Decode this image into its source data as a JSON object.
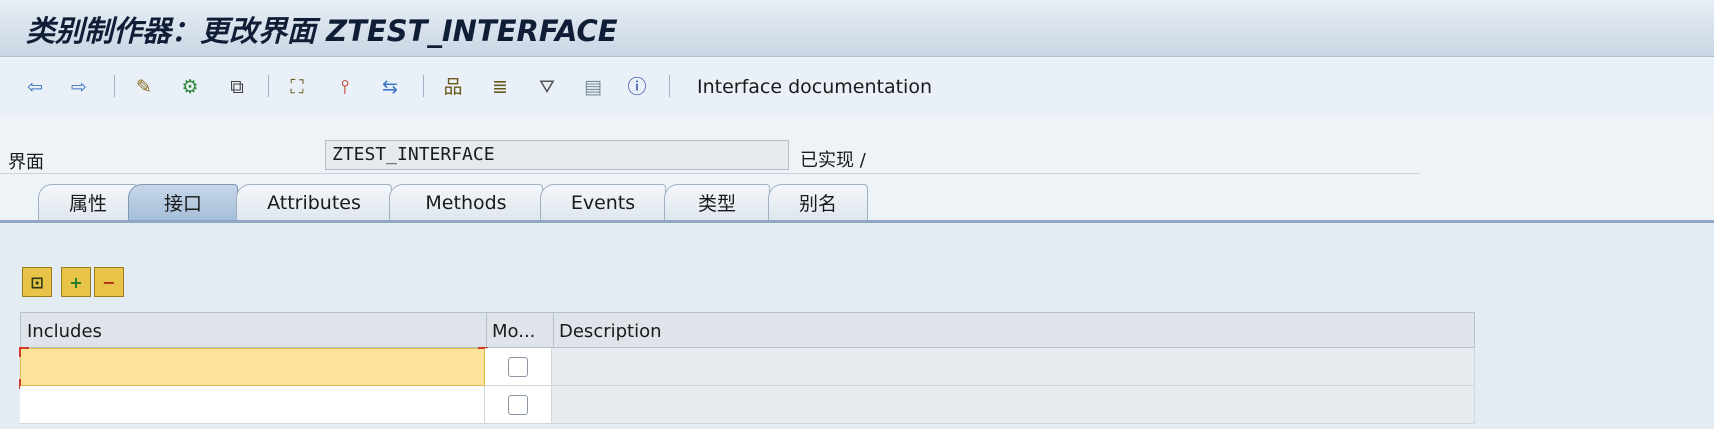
{
  "window": {
    "title": "类别制作器：更改界面 ZTEST_INTERFACE"
  },
  "toolbar": {
    "buttons": [
      {
        "name": "back-icon",
        "glyph": "⇦"
      },
      {
        "name": "forward-icon",
        "glyph": "⇨"
      },
      {
        "name": "edit-toggle-icon",
        "glyph": "✎"
      },
      {
        "name": "check-icon",
        "glyph": "⚙"
      },
      {
        "name": "activate-icon",
        "glyph": "⧉"
      },
      {
        "name": "hierarchy-icon",
        "glyph": "⛶"
      },
      {
        "name": "where-used-icon",
        "glyph": "⫯"
      },
      {
        "name": "navigate-icon",
        "glyph": "⇆"
      },
      {
        "name": "display-object-list-icon",
        "glyph": "品"
      },
      {
        "name": "class-browser-icon",
        "glyph": "≣"
      },
      {
        "name": "filter-icon",
        "glyph": "⛛"
      },
      {
        "name": "list-icon",
        "glyph": "▤"
      },
      {
        "name": "info-icon",
        "glyph": "ⓘ"
      }
    ],
    "doc_label": "Interface documentation"
  },
  "header": {
    "interface_label": "界面",
    "interface_value": "ZTEST_INTERFACE",
    "status": "已实现 /"
  },
  "tabs": [
    {
      "label": "属性",
      "active": false
    },
    {
      "label": "接口",
      "active": true
    },
    {
      "label": "Attributes",
      "active": false
    },
    {
      "label": "Methods",
      "active": false
    },
    {
      "label": "Events",
      "active": false
    },
    {
      "label": "类型",
      "active": false
    },
    {
      "label": "别名",
      "active": false
    }
  ],
  "grid_toolbar": {
    "buttons": [
      {
        "name": "detail-icon",
        "glyph": "⊡"
      },
      {
        "name": "insert-row-icon",
        "glyph": "+"
      },
      {
        "name": "delete-row-icon",
        "glyph": "−"
      }
    ]
  },
  "grid": {
    "columns": [
      "Includes",
      "Mo...",
      "Description"
    ],
    "rows": [
      {
        "include": "",
        "modeled": false,
        "description": ""
      },
      {
        "include": "",
        "modeled": false,
        "description": ""
      }
    ]
  }
}
